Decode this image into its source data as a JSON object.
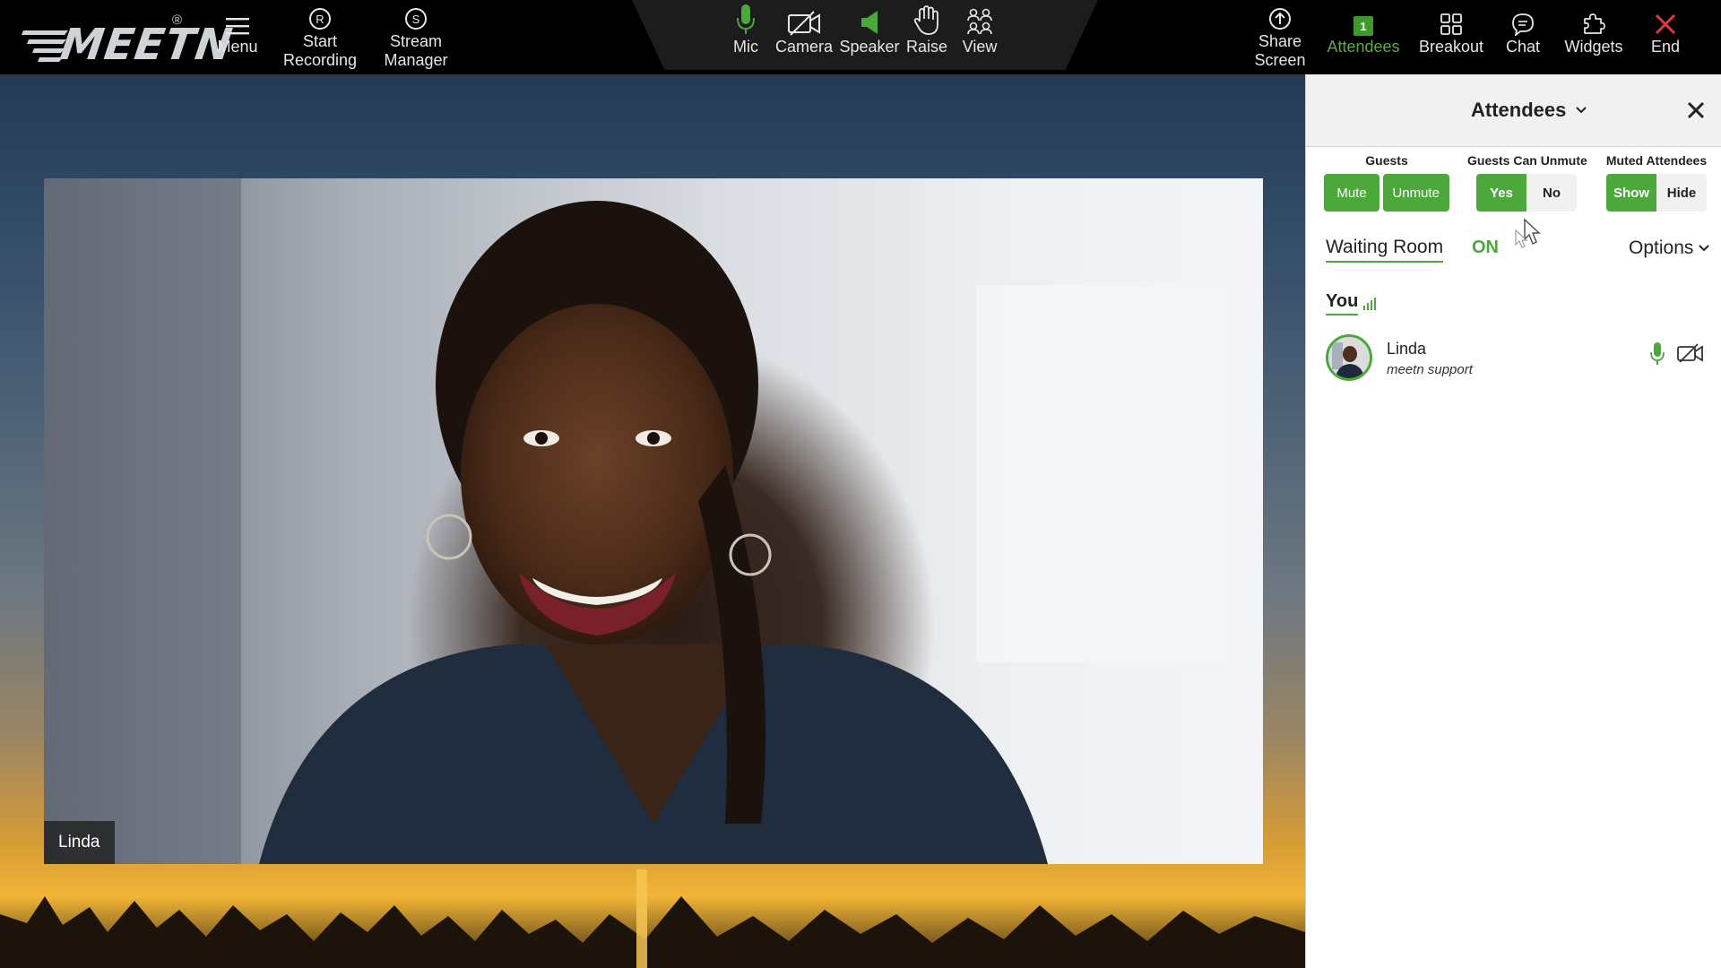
{
  "app": {
    "brand": "MEETN",
    "brand_mark": "®"
  },
  "toolbar": {
    "menu": "Menu",
    "start_recording_1": "Start",
    "start_recording_2": "Recording",
    "stream_manager_1": "Stream",
    "stream_manager_2": "Manager",
    "mic": "Mic",
    "camera": "Camera",
    "speaker": "Speaker",
    "raise": "Raise",
    "view": "View",
    "share_screen_1": "Share",
    "share_screen_2": "Screen",
    "attendees": "Attendees",
    "attendees_count": "1",
    "breakout": "Breakout",
    "chat": "Chat",
    "widgets": "Widgets",
    "end": "End"
  },
  "colors": {
    "accent": "#4ca83a",
    "end": "#e03c3c",
    "topbar": "#000000"
  },
  "video": {
    "participant_name": "Linda"
  },
  "panel": {
    "title": "Attendees",
    "guests": {
      "label": "Guests",
      "mute": "Mute",
      "unmute": "Unmute"
    },
    "guests_can_unmute": {
      "label": "Guests Can Unmute",
      "yes": "Yes",
      "no": "No"
    },
    "muted_attendees": {
      "label": "Muted Attendees",
      "show": "Show",
      "hide": "Hide"
    },
    "waiting_room": {
      "label": "Waiting Room",
      "state": "ON"
    },
    "options": "Options",
    "you_section": "You",
    "attendees": [
      {
        "name": "Linda",
        "org": "meetn support",
        "mic_icon": "mic-on-icon",
        "camera_icon": "camera-off-icon"
      }
    ]
  }
}
